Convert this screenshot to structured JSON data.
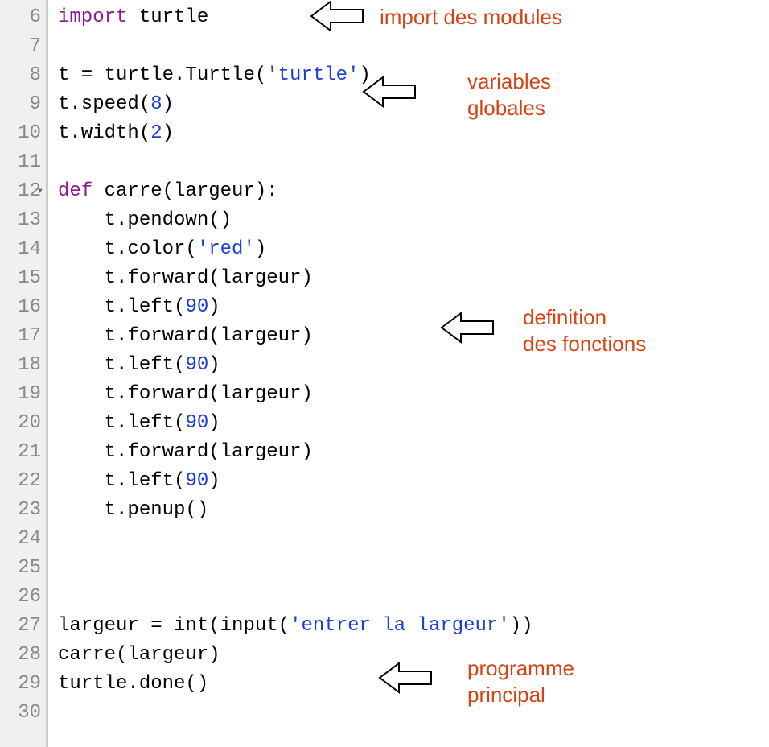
{
  "lineNumbers": [
    "6",
    "7",
    "8",
    "9",
    "10",
    "11",
    "12",
    "13",
    "14",
    "15",
    "16",
    "17",
    "18",
    "19",
    "20",
    "21",
    "22",
    "23",
    "24",
    "25",
    "26",
    "27",
    "28",
    "29",
    "30"
  ],
  "foldLine": "12",
  "code": {
    "l6": {
      "segments": [
        {
          "t": "kw",
          "v": "import"
        },
        {
          "t": "id",
          "v": " turtle"
        }
      ]
    },
    "l7": {
      "segments": []
    },
    "l8": {
      "segments": [
        {
          "t": "id",
          "v": "t = turtle.Turtle("
        },
        {
          "t": "str",
          "v": "'turtle'"
        },
        {
          "t": "id",
          "v": ")"
        }
      ]
    },
    "l9": {
      "segments": [
        {
          "t": "id",
          "v": "t.speed("
        },
        {
          "t": "num",
          "v": "8"
        },
        {
          "t": "id",
          "v": ")"
        }
      ]
    },
    "l10": {
      "segments": [
        {
          "t": "id",
          "v": "t.width("
        },
        {
          "t": "num",
          "v": "2"
        },
        {
          "t": "id",
          "v": ")"
        }
      ]
    },
    "l11": {
      "segments": []
    },
    "l12": {
      "segments": [
        {
          "t": "kw",
          "v": "def"
        },
        {
          "t": "id",
          "v": " carre(largeur):"
        }
      ]
    },
    "l13": {
      "segments": [
        {
          "t": "id",
          "v": "    t.pendown()"
        }
      ]
    },
    "l14": {
      "segments": [
        {
          "t": "id",
          "v": "    t.color("
        },
        {
          "t": "str",
          "v": "'red'"
        },
        {
          "t": "id",
          "v": ")"
        }
      ]
    },
    "l15": {
      "segments": [
        {
          "t": "id",
          "v": "    t.forward(largeur)"
        }
      ]
    },
    "l16": {
      "segments": [
        {
          "t": "id",
          "v": "    t.left("
        },
        {
          "t": "num",
          "v": "90"
        },
        {
          "t": "id",
          "v": ")"
        }
      ]
    },
    "l17": {
      "segments": [
        {
          "t": "id",
          "v": "    t.forward(largeur)"
        }
      ]
    },
    "l18": {
      "segments": [
        {
          "t": "id",
          "v": "    t.left("
        },
        {
          "t": "num",
          "v": "90"
        },
        {
          "t": "id",
          "v": ")"
        }
      ]
    },
    "l19": {
      "segments": [
        {
          "t": "id",
          "v": "    t.forward(largeur)"
        }
      ]
    },
    "l20": {
      "segments": [
        {
          "t": "id",
          "v": "    t.left("
        },
        {
          "t": "num",
          "v": "90"
        },
        {
          "t": "id",
          "v": ")"
        }
      ]
    },
    "l21": {
      "segments": [
        {
          "t": "id",
          "v": "    t.forward(largeur)"
        }
      ]
    },
    "l22": {
      "segments": [
        {
          "t": "id",
          "v": "    t.left("
        },
        {
          "t": "num",
          "v": "90"
        },
        {
          "t": "id",
          "v": ")"
        }
      ]
    },
    "l23": {
      "segments": [
        {
          "t": "id",
          "v": "    t.penup()"
        }
      ]
    },
    "l24": {
      "segments": []
    },
    "l25": {
      "segments": []
    },
    "l26": {
      "segments": []
    },
    "l27": {
      "segments": [
        {
          "t": "id",
          "v": "largeur = "
        },
        {
          "t": "fn",
          "v": "int"
        },
        {
          "t": "id",
          "v": "("
        },
        {
          "t": "fn",
          "v": "input"
        },
        {
          "t": "id",
          "v": "("
        },
        {
          "t": "str",
          "v": "'entrer la largeur'"
        },
        {
          "t": "id",
          "v": "))"
        }
      ]
    },
    "l28": {
      "segments": [
        {
          "t": "id",
          "v": "carre(largeur)"
        }
      ]
    },
    "l29": {
      "segments": [
        {
          "t": "id",
          "v": "turtle.done()"
        }
      ]
    },
    "l30": {
      "segments": []
    }
  },
  "annotations": {
    "a1": "import des modules",
    "a2": "variables\nglobales",
    "a3": "definition\ndes fonctions",
    "a4": "programme\nprincipal"
  }
}
